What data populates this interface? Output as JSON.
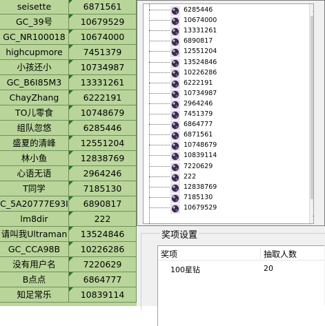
{
  "sheet": {
    "rows": [
      {
        "name": "seisette",
        "id": "6871561"
      },
      {
        "name": "GC_39号",
        "id": "10679529"
      },
      {
        "name": "GC_NR100018",
        "id": "10674000"
      },
      {
        "name": "highcupmore",
        "id": "7451379"
      },
      {
        "name": "小孩还小",
        "id": "10734987"
      },
      {
        "name": "GC_B6I85M3",
        "id": "13331261"
      },
      {
        "name": "ChayZhang",
        "id": "6222191"
      },
      {
        "name": "TO儿零食",
        "id": "10748679"
      },
      {
        "name": "组队忽悠",
        "id": "6285446"
      },
      {
        "name": "盛夏的清峰",
        "id": "12551204"
      },
      {
        "name": "林小鱼",
        "id": "12838769"
      },
      {
        "name": "心语无语",
        "id": "2964246"
      },
      {
        "name": "T同学",
        "id": "7185130"
      },
      {
        "name": "C_5A20777E93I",
        "id": "6890817"
      },
      {
        "name": "lm8dir",
        "id": "222"
      },
      {
        "name": "请叫我Ultraman",
        "id": "13524846"
      },
      {
        "name": "GC_CCA98B",
        "id": "10226286"
      },
      {
        "name": "没有用户名",
        "id": "7220629"
      },
      {
        "name": "B点点",
        "id": "6864777"
      },
      {
        "name": "知足常乐",
        "id": "10839114"
      }
    ]
  },
  "list": {
    "items": [
      "6285446",
      "10674000",
      "13331261",
      "6890817",
      "12551204",
      "13524846",
      "10226286",
      "6222191",
      "10734987",
      "2964246",
      "7451379",
      "6864777",
      "6871561",
      "10748679",
      "10839114",
      "7220629",
      "222",
      "12838769",
      "7185130",
      "10679529"
    ]
  },
  "group": {
    "title": "奖项设置",
    "col_award": "奖项",
    "col_count": "抽取人数",
    "row_award": "100星钻",
    "row_count": "20"
  },
  "colors": {
    "sheet_bg": "#b9d59a",
    "panel_bg": "#f0f0f0"
  }
}
